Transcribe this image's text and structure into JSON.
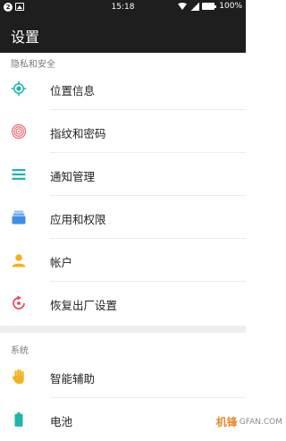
{
  "status_bar": {
    "notification_badge": "2",
    "time": "15:18",
    "battery": "100%",
    "icons": [
      "notification-badge-icon",
      "image-icon",
      "wifi-icon",
      "signal-icon",
      "battery-icon"
    ]
  },
  "app_bar": {
    "title": "设置"
  },
  "sections": [
    {
      "header": "隐私和安全",
      "items": [
        {
          "label": "位置信息",
          "icon": "location-icon",
          "color": "#1fb5a8"
        },
        {
          "label": "指纹和密码",
          "icon": "fingerprint-icon",
          "color": "#f06a76"
        },
        {
          "label": "通知管理",
          "icon": "notification-list-icon",
          "color": "#1fb5a8"
        },
        {
          "label": "应用和权限",
          "icon": "apps-stack-icon",
          "color": "#3f8ee6"
        },
        {
          "label": "帐户",
          "icon": "account-icon",
          "color": "#f2b21c"
        },
        {
          "label": "恢复出厂设置",
          "icon": "factory-reset-icon",
          "color": "#e8465a"
        }
      ]
    },
    {
      "header": "系统",
      "items": [
        {
          "label": "智能辅助",
          "icon": "hand-icon",
          "color": "#f2b21c"
        },
        {
          "label": "电池",
          "icon": "battery-icon",
          "color": "#1fb5a8"
        }
      ]
    }
  ],
  "watermark": {
    "logo": "机锋",
    "text": "GFAN.COM"
  }
}
